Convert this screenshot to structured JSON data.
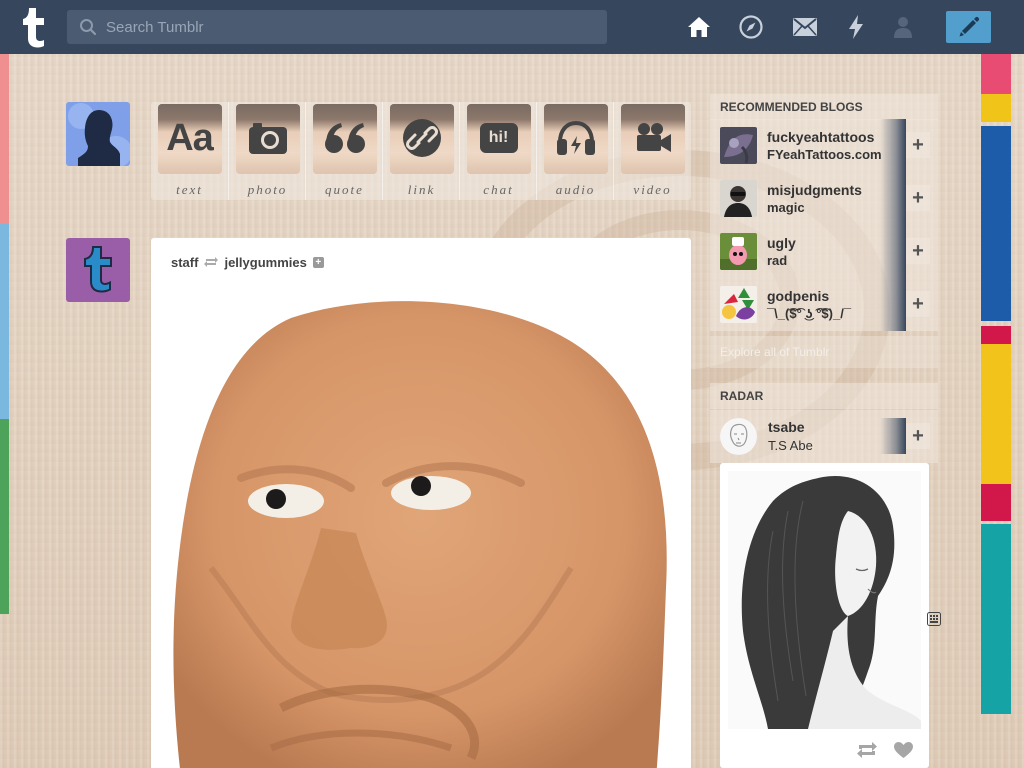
{
  "header": {
    "search_placeholder": "Search Tumblr"
  },
  "post_types": [
    {
      "label": "text",
      "icon": "text-aa-icon"
    },
    {
      "label": "photo",
      "icon": "camera-icon"
    },
    {
      "label": "quote",
      "icon": "quote-icon"
    },
    {
      "label": "link",
      "icon": "link-icon"
    },
    {
      "label": "chat",
      "icon": "chat-bubble-icon"
    },
    {
      "label": "audio",
      "icon": "headphones-icon"
    },
    {
      "label": "video",
      "icon": "video-camera-icon"
    }
  ],
  "text_glyph": "Aa",
  "chat_glyph": "hi!",
  "post": {
    "author": "staff",
    "reblogged_from": "jellygummies"
  },
  "recommended": {
    "title": "RECOMMENDED BLOGS",
    "blogs": [
      {
        "name": "fuckyeahtattoos",
        "sub": "FYeahTattoos.com"
      },
      {
        "name": "misjudgments",
        "sub": "magic"
      },
      {
        "name": "ugly",
        "sub": "rad"
      },
      {
        "name": "godpenis",
        "sub": "¯\\_(͡$͡° ͜ʖ ͡°͡$)_/¯"
      }
    ],
    "follow_label": "+",
    "explore": "Explore all of Tumblr"
  },
  "radar": {
    "title": "RADAR",
    "name": "tsabe",
    "sub": "T.S Abe",
    "follow_label": "+"
  },
  "colors": {
    "header": "#36465d",
    "compose": "#529ecc",
    "background": "#e3d3c2"
  }
}
